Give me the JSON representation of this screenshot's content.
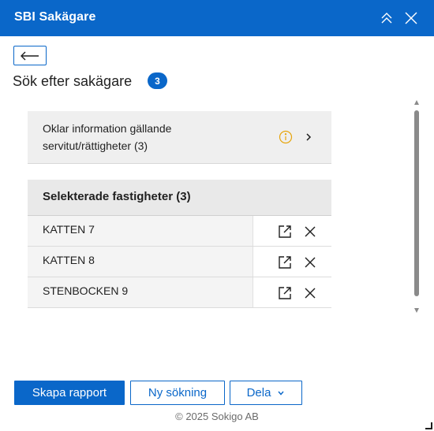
{
  "header": {
    "title": "SBI Sakägare",
    "color": "#0a67c9",
    "icons": {
      "collapse": "double-chevron-up-icon",
      "close": "close-icon"
    }
  },
  "back_button": {
    "icon": "arrow-left-icon"
  },
  "page": {
    "title": "Sök efter sakägare",
    "badge_count": "3"
  },
  "info_row": {
    "text": "Oklar information gällande servitut/rättigheter (3)",
    "icons": {
      "info": "info-circle-icon",
      "chevron": "chevron-right-icon"
    },
    "info_color": "#e7a50c"
  },
  "selected": {
    "header": "Selekterade fastigheter (3)",
    "items": [
      {
        "name": "KATTEN 7"
      },
      {
        "name": "KATTEN 8"
      },
      {
        "name": "STENBOCKEN 9"
      }
    ]
  },
  "actions": {
    "create_report": "Skapa rapport",
    "new_search": "Ny sökning",
    "share": "Dela"
  },
  "footer": {
    "copyright": "© 2025 Sokigo AB"
  }
}
